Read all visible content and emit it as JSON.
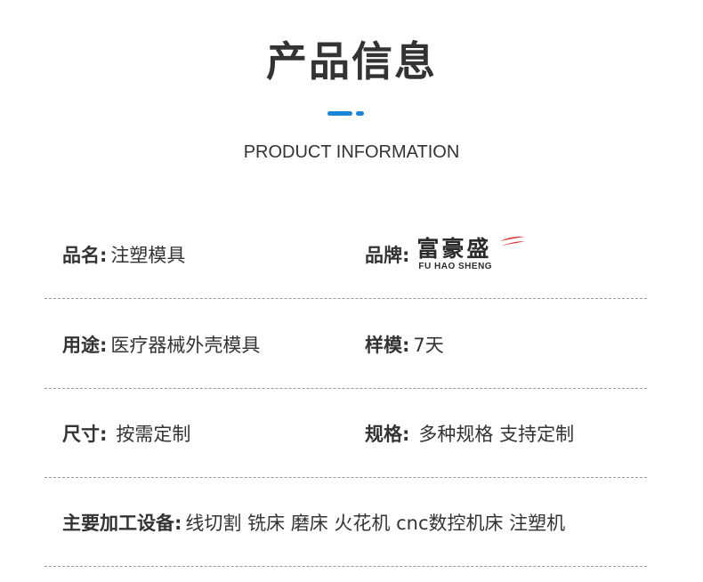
{
  "header": {
    "title": "产品信息",
    "subtitle": "PRODUCT INFORMATION",
    "accent_color": "#1a86d8"
  },
  "rows": [
    {
      "left": {
        "label": "品名:",
        "value": "注塑模具"
      },
      "right": {
        "label": "品牌:",
        "brand_logo": {
          "cn": "富豪盛",
          "en": "FU HAO SHENG",
          "swoosh_color": "#d9302c"
        }
      }
    },
    {
      "left": {
        "label": "用途:",
        "value": "医疗器械外壳模具"
      },
      "right": {
        "label": "样模:",
        "value": "7天"
      }
    },
    {
      "left": {
        "label": "尺寸:",
        "value": "按需定制"
      },
      "right": {
        "label": "规格:",
        "value": "多种规格 支持定制"
      }
    },
    {
      "full": {
        "label": "主要加工设备:",
        "value": "线切割 铣床 磨床 火花机 cnc数控机床 注塑机"
      }
    }
  ]
}
